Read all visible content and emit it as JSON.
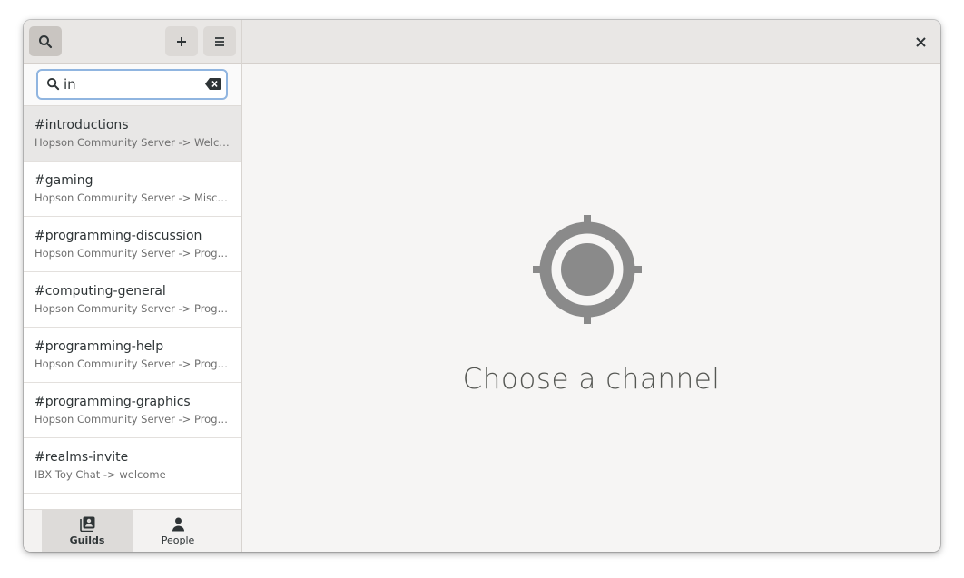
{
  "sidebar": {
    "search": {
      "value": "in",
      "placeholder": ""
    },
    "channels": [
      {
        "name": "#introductions",
        "path": "Hopson Community Server -> Welcome"
      },
      {
        "name": "#gaming",
        "path": "Hopson Community Server -> Miscell..."
      },
      {
        "name": "#programming-discussion",
        "path": "Hopson Community Server -> Progra..."
      },
      {
        "name": "#computing-general",
        "path": "Hopson Community Server -> Progra..."
      },
      {
        "name": "#programming-help",
        "path": "Hopson Community Server -> Progra..."
      },
      {
        "name": "#programming-graphics",
        "path": "Hopson Community Server -> Progra..."
      },
      {
        "name": "#realms-invite",
        "path": "IBX Toy Chat -> welcome"
      }
    ],
    "tabs": {
      "guilds": "Guilds",
      "people": "People"
    }
  },
  "main": {
    "empty_title": "Choose a channel"
  },
  "colors": {
    "accent_border": "#90b5e0",
    "icon_gray": "#8a8a8a",
    "text": "#2e3436"
  },
  "icons": [
    "search-icon",
    "plus-icon",
    "menu-icon",
    "clear-text-icon",
    "close-icon",
    "guilds-icon",
    "person-icon",
    "target-icon"
  ]
}
